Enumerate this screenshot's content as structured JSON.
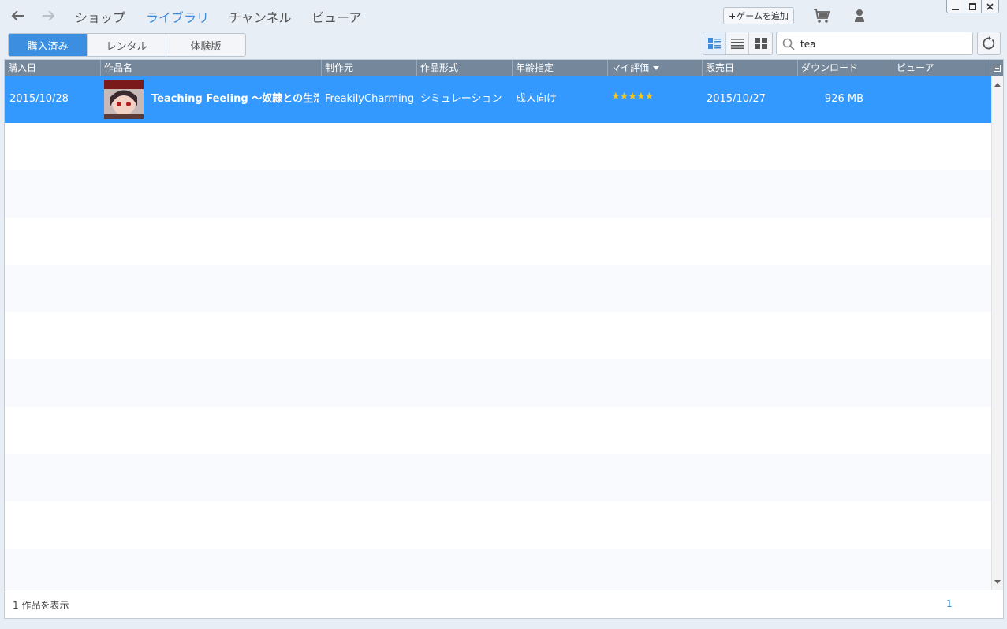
{
  "nav": {
    "back_icon": "arrow-left-icon",
    "forward_icon": "arrow-right-icon",
    "links": [
      "ショップ",
      "ライブラリ",
      "チャンネル",
      "ビューア"
    ],
    "active_link": "ライブラリ",
    "add_game_plus": "+",
    "add_game_label": "ゲームを追加",
    "cart_icon": "cart-icon",
    "user_icon": "user-icon"
  },
  "window_controls": [
    "minimize-icon",
    "maximize-icon",
    "close-icon"
  ],
  "tabs": [
    "購入済み",
    "レンタル",
    "体験版"
  ],
  "active_tab": "購入済み",
  "view_modes": [
    "list-detail-icon",
    "list-icon",
    "grid-icon"
  ],
  "search": {
    "value": "tea",
    "icon": "search-icon"
  },
  "refresh_icon": "refresh-icon",
  "columns": [
    "購入日",
    "作品名",
    "制作元",
    "作品形式",
    "年齢指定",
    "マイ評価",
    "販売日",
    "ダウンロード",
    "ビューア"
  ],
  "sorted_column": "マイ評価",
  "rows": [
    {
      "purchase_date": "2015/10/28",
      "title": "Teaching Feeling ～奴隷との生活～",
      "maker": "FreakilyCharming",
      "format": "シミュレーション",
      "age_rating": "成人向け",
      "rating": 5,
      "rating_stars": "★★★★★",
      "release_date": "2015/10/27",
      "download_size": "926 MB",
      "viewer": "",
      "selected": true
    }
  ],
  "footer": {
    "count_label": "1 作品を表示",
    "page": "1"
  },
  "colors": {
    "accent": "#3b8ee0",
    "selected_row": "#3399ff",
    "header": "#74879b",
    "star": "#f5c518"
  }
}
